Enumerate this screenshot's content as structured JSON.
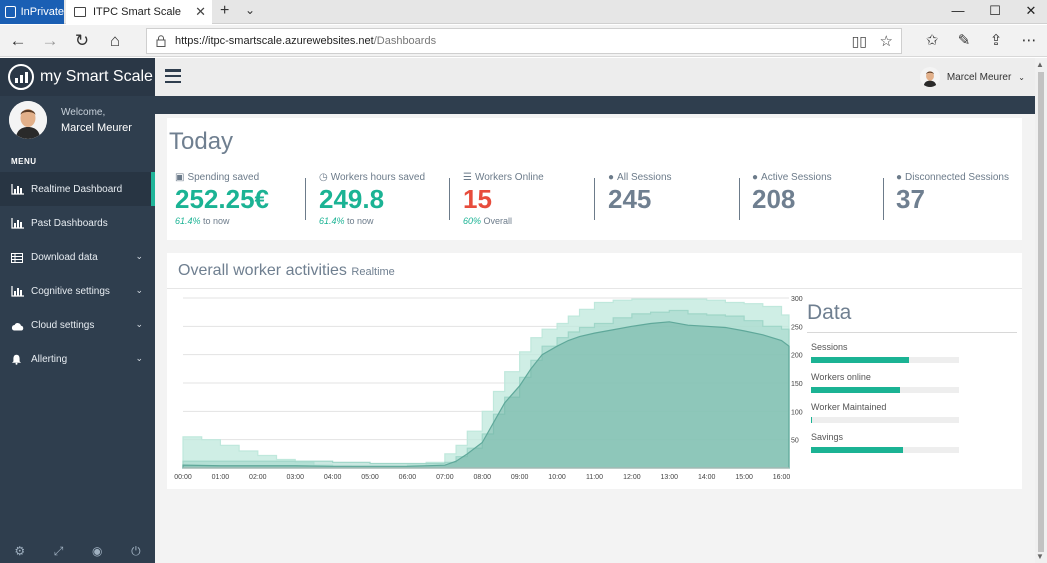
{
  "browser": {
    "inprivate_label": "InPrivate",
    "tab_title": "ITPC Smart Scale",
    "tab_close": "✕",
    "new_tab": "+",
    "tab_list": "⌄",
    "url_host": "https://itpc-smartscale.azurewebsites.net",
    "url_path": "/Dashboards",
    "icons": [
      "back-icon",
      "forward-icon",
      "refresh-icon",
      "home-icon",
      "lock-icon",
      "reading-view-icon",
      "favorite-star-icon",
      "favorites-hub-icon",
      "pen-icon",
      "share-icon",
      "more-icon"
    ]
  },
  "sidebar": {
    "brand": "my Smart Scale",
    "welcome": "Welcome,",
    "user_name": "Marcel Meurer",
    "menu_label": "MENU",
    "items": [
      {
        "label": "Realtime Dashboard",
        "icon": "bar-chart-icon",
        "active": true
      },
      {
        "label": "Past Dashboards",
        "icon": "bar-chart-icon"
      },
      {
        "label": "Download data",
        "icon": "table-icon",
        "expandable": true
      },
      {
        "label": "Cognitive settings",
        "icon": "bar-chart-icon",
        "expandable": true
      },
      {
        "label": "Cloud settings",
        "icon": "cloud-icon",
        "expandable": true
      },
      {
        "label": "Allerting",
        "icon": "bell-icon",
        "expandable": true
      }
    ],
    "footer_icons": [
      "gear-icon",
      "fullscreen-icon",
      "eye-slash-icon",
      "power-icon"
    ]
  },
  "header": {
    "user_name": "Marcel Meurer"
  },
  "today": {
    "title": "Today",
    "stats": [
      {
        "label": "Spending saved",
        "icon": "money-icon",
        "value": "252.25€",
        "sub_pct": "61.4%",
        "sub_text": " to now",
        "color": "#1bb394"
      },
      {
        "label": "Workers hours saved",
        "icon": "clock-icon",
        "value": "249.8",
        "sub_pct": "61.4%",
        "sub_text": " to now",
        "color": "#1bb394"
      },
      {
        "label": "Workers Online",
        "icon": "server-icon",
        "value": "15",
        "sub_pct": "60%",
        "sub_text": " Overall",
        "color": "#e74c3c"
      },
      {
        "label": "All Sessions",
        "icon": "user-icon",
        "value": "245",
        "sub_pct": "",
        "sub_text": "",
        "color": "#6f7f90"
      },
      {
        "label": "Active Sessions",
        "icon": "user-icon",
        "value": "208",
        "sub_pct": "",
        "sub_text": "",
        "color": "#6f7f90"
      },
      {
        "label": "Disconnected Sessions",
        "icon": "user-icon",
        "value": "37",
        "sub_pct": "",
        "sub_text": "",
        "color": "#6f7f90"
      }
    ]
  },
  "activity": {
    "title": "Overall worker activities",
    "subtitle": "Realtime"
  },
  "chart_data": {
    "type": "area",
    "title": "Overall worker activities",
    "x_ticks": [
      "00:00",
      "01:00",
      "02:00",
      "03:00",
      "04:00",
      "05:00",
      "06:00",
      "07:00",
      "08:00",
      "09:00",
      "10:00",
      "11:00",
      "12:00",
      "13:00",
      "14:00",
      "15:00",
      "16:00"
    ],
    "y_ticks": [
      50,
      100,
      150,
      200,
      250,
      300
    ],
    "ylim": [
      0,
      300
    ],
    "xlim_hours": [
      0,
      16.2
    ],
    "series": [
      {
        "color": "#bfe8dc",
        "x": [
          0,
          0.5,
          1,
          1.5,
          2,
          2.5,
          3,
          3.5,
          4,
          4.5,
          5,
          5.5,
          6,
          6.5,
          7,
          7.3,
          7.6,
          8,
          8.3,
          8.6,
          9,
          9.3,
          9.6,
          10,
          10.3,
          10.6,
          11,
          11.5,
          12,
          12.5,
          13,
          13.5,
          14,
          14.5,
          15,
          15.5,
          16,
          16.2
        ],
        "y": [
          55,
          50,
          40,
          30,
          22,
          15,
          10,
          5,
          3,
          2,
          2,
          2,
          5,
          10,
          25,
          40,
          65,
          100,
          135,
          170,
          205,
          230,
          245,
          255,
          268,
          280,
          292,
          296,
          298,
          298,
          298,
          298,
          296,
          292,
          290,
          285,
          270,
          265
        ]
      },
      {
        "color": "#9fd6c8",
        "x": [
          0,
          1,
          2,
          3,
          4,
          5,
          6,
          7,
          7.3,
          7.6,
          8,
          8.3,
          8.6,
          9,
          9.3,
          9.6,
          10,
          10.3,
          10.6,
          11,
          11.5,
          12,
          12.5,
          13,
          13.5,
          14,
          14.5,
          15,
          15.5,
          16,
          16.2
        ],
        "y": [
          12,
          12,
          12,
          12,
          10,
          8,
          8,
          10,
          20,
          35,
          60,
          95,
          125,
          160,
          190,
          215,
          230,
          240,
          248,
          255,
          265,
          272,
          275,
          278,
          272,
          270,
          268,
          260,
          250,
          245,
          240
        ]
      },
      {
        "color": "#5fa89a",
        "x": [
          0,
          1,
          2,
          3,
          4,
          5,
          6,
          7,
          7.3,
          7.6,
          8,
          8.3,
          8.6,
          9,
          9.3,
          9.6,
          10,
          10.3,
          10.6,
          11,
          11.5,
          12,
          12.5,
          13,
          13.5,
          14,
          14.5,
          15,
          15.5,
          16,
          16.2
        ],
        "y": [
          5,
          4,
          4,
          4,
          3,
          3,
          3,
          5,
          12,
          25,
          45,
          80,
          115,
          145,
          175,
          200,
          215,
          225,
          232,
          238,
          244,
          250,
          255,
          258,
          252,
          250,
          248,
          242,
          235,
          225,
          215
        ]
      }
    ]
  },
  "data_panel": {
    "title": "Data",
    "bars": [
      {
        "label": "Sessions",
        "fraction": 0.66
      },
      {
        "label": "Workers online",
        "fraction": 0.6
      },
      {
        "label": "Worker Maintained",
        "fraction": 0.01
      },
      {
        "label": "Savings",
        "fraction": 0.62
      }
    ]
  }
}
